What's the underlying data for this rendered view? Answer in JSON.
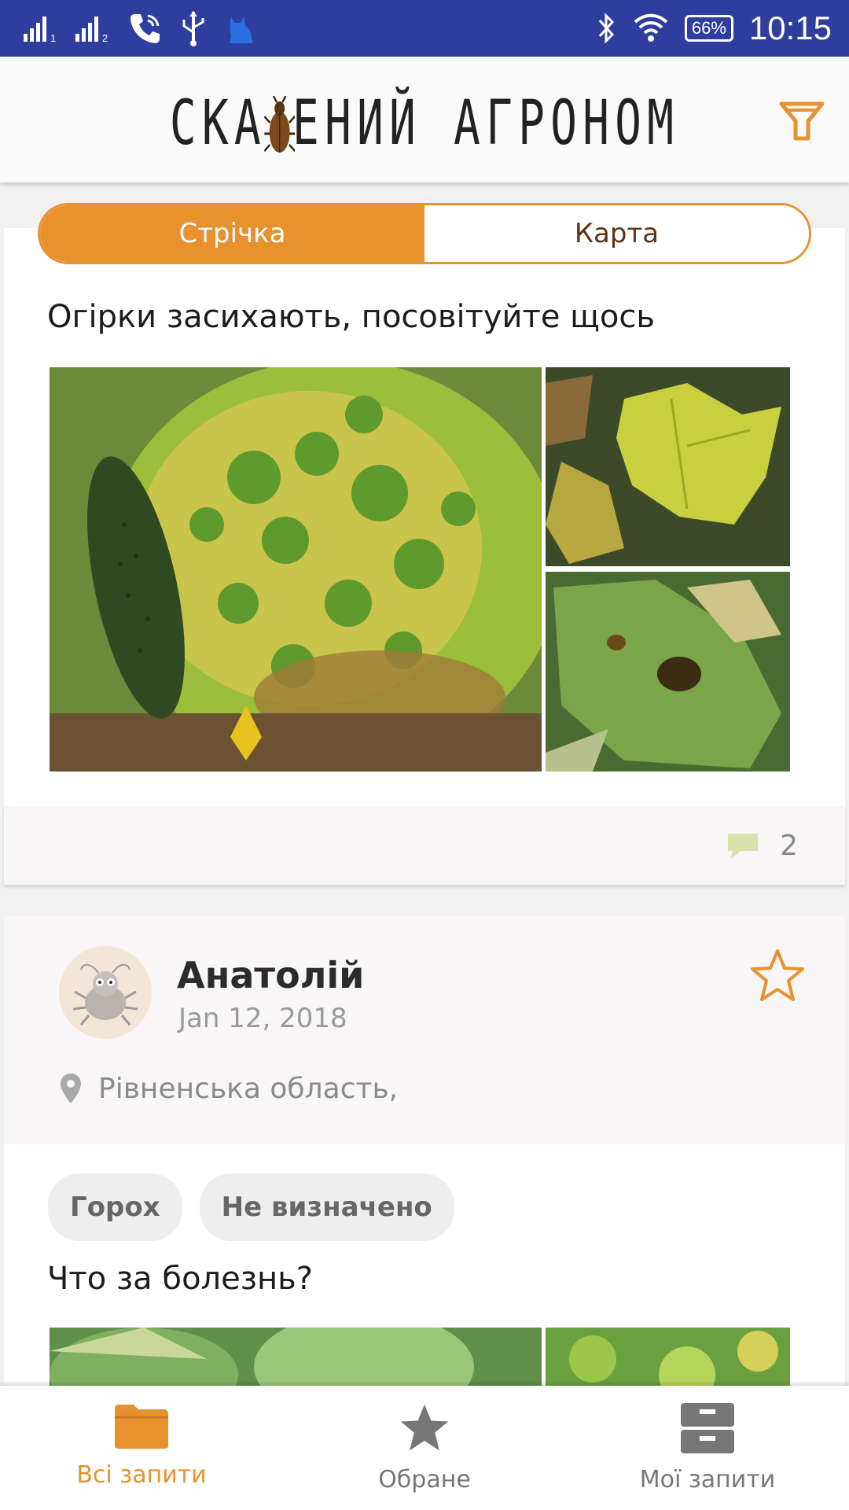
{
  "status_bar": {
    "battery": "66%",
    "time": "10:15",
    "icons": [
      "signal-sim1-icon",
      "signal-sim2-icon",
      "phone-icon",
      "usb-icon",
      "cat-icon",
      "bluetooth-icon",
      "wifi-icon",
      "battery-icon"
    ]
  },
  "header": {
    "logo_text_left": "СКА",
    "logo_text_right": "ЕНИЙ АГРОНОМ",
    "filter_icon": "filter-icon"
  },
  "tabs": [
    {
      "label": "Стрічка",
      "active": true
    },
    {
      "label": "Карта",
      "active": false
    }
  ],
  "feed": {
    "post1": {
      "title": "Огірки засихають, посовітуйте щось",
      "comments_count": "2",
      "images": [
        "cucumber-leaf-mosaic",
        "cucumber-yellow-leaf",
        "cucumber-spotted-leaf"
      ]
    },
    "post2": {
      "author": "Анатолій",
      "date": "Jan 12, 2018",
      "location": "Рівненська область,",
      "tags": [
        "Горох",
        "Не визначено"
      ],
      "title": "Что за болезнь?"
    }
  },
  "bottom_nav": [
    {
      "label": "Всі запити",
      "icon": "folder-icon",
      "active": true
    },
    {
      "label": "Обране",
      "icon": "star-icon",
      "active": false
    },
    {
      "label": "Мої запити",
      "icon": "archive-icon",
      "active": false
    }
  ],
  "colors": {
    "accent": "#e8912f",
    "status_bar": "#2f3e9e",
    "tab_inactive_text": "#5a3414"
  }
}
